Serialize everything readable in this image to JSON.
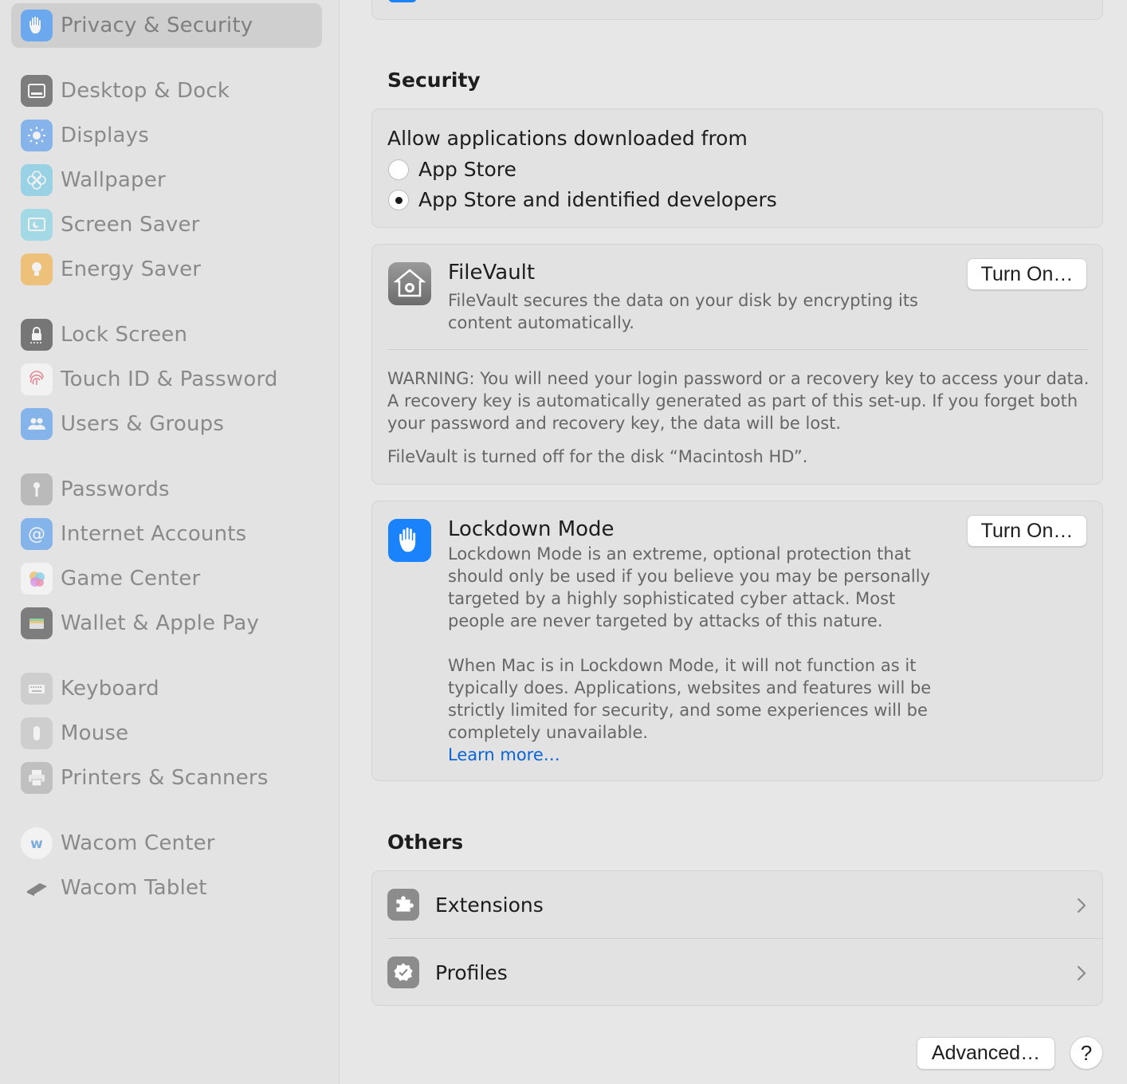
{
  "sidebar": {
    "selected": {
      "label": "Privacy & Security",
      "icon": "hand-raised-icon"
    },
    "groups": [
      [
        {
          "label": "Desktop & Dock",
          "icon": "dock-icon"
        },
        {
          "label": "Displays",
          "icon": "sun-icon"
        },
        {
          "label": "Wallpaper",
          "icon": "flower-icon"
        },
        {
          "label": "Screen Saver",
          "icon": "screen-saver-icon"
        },
        {
          "label": "Energy Saver",
          "icon": "lightbulb-icon"
        }
      ],
      [
        {
          "label": "Lock Screen",
          "icon": "lock-icon"
        },
        {
          "label": "Touch ID & Password",
          "icon": "fingerprint-icon"
        },
        {
          "label": "Users & Groups",
          "icon": "users-icon"
        }
      ],
      [
        {
          "label": "Passwords",
          "icon": "key-icon"
        },
        {
          "label": "Internet Accounts",
          "icon": "at-sign-icon"
        },
        {
          "label": "Game Center",
          "icon": "game-center-icon"
        },
        {
          "label": "Wallet & Apple Pay",
          "icon": "wallet-icon"
        }
      ],
      [
        {
          "label": "Keyboard",
          "icon": "keyboard-icon"
        },
        {
          "label": "Mouse",
          "icon": "mouse-icon"
        },
        {
          "label": "Printers & Scanners",
          "icon": "printer-icon"
        }
      ],
      [
        {
          "label": "Wacom Center",
          "icon": "wacom-center-icon"
        },
        {
          "label": "Wacom Tablet",
          "icon": "wacom-tablet-icon"
        }
      ]
    ]
  },
  "security": {
    "title": "Security",
    "allow_label": "Allow applications downloaded from",
    "options": [
      {
        "label": "App Store",
        "selected": false
      },
      {
        "label": "App Store and identified developers",
        "selected": true
      }
    ]
  },
  "filevault": {
    "title": "FileVault",
    "description_line1": "FileVault secures the data on your disk by encrypting its",
    "description_line2": "content automatically.",
    "button": "Turn On…",
    "warning_line1": "WARNING: You will need your login password or a recovery key to access your data.",
    "warning_line2": "A recovery key is automatically generated as part of this set-up. If you forget both",
    "warning_line3": "your password and recovery key, the data will be lost.",
    "status": "FileVault is turned off for the disk “Macintosh HD”."
  },
  "lockdown": {
    "title": "Lockdown Mode",
    "button": "Turn On…",
    "p1": [
      "Lockdown Mode is an extreme, optional protection that",
      "should only be used if you believe you may be personally",
      "targeted by a highly sophisticated cyber attack. Most",
      "people are never targeted by attacks of this nature."
    ],
    "p2": [
      "When Mac is in Lockdown Mode, it will not function as it",
      "typically does. Applications, websites and features will be",
      "strictly limited for security, and some experiences will be",
      "completely unavailable."
    ],
    "learn_more": "Learn more…",
    "link_color": "#0a64d8"
  },
  "others": {
    "title": "Others",
    "items": [
      {
        "label": "Extensions",
        "icon": "puzzle-icon"
      },
      {
        "label": "Profiles",
        "icon": "checkmark-badge-icon"
      }
    ]
  },
  "footer": {
    "advanced_button": "Advanced…",
    "help_button": "?"
  },
  "colors": {
    "accent_blue": "#1a82fb",
    "link": "#0a64d8"
  }
}
